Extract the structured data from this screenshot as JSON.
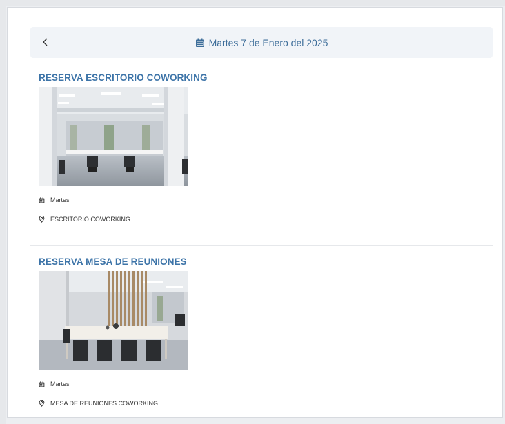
{
  "header": {
    "date_title": "Martes 7 de Enero del 2025"
  },
  "reservations": [
    {
      "title": "RESERVA ESCRITORIO COWORKING",
      "day": "Martes",
      "location": "ESCRITORIO COWORKING"
    },
    {
      "title": "RESERVA MESA DE REUNIONES",
      "day": "Martes",
      "location": "MESA DE REUNIONES COWORKING"
    }
  ],
  "colors": {
    "accent": "#3d74a8",
    "header_bg": "#f1f4f8"
  }
}
